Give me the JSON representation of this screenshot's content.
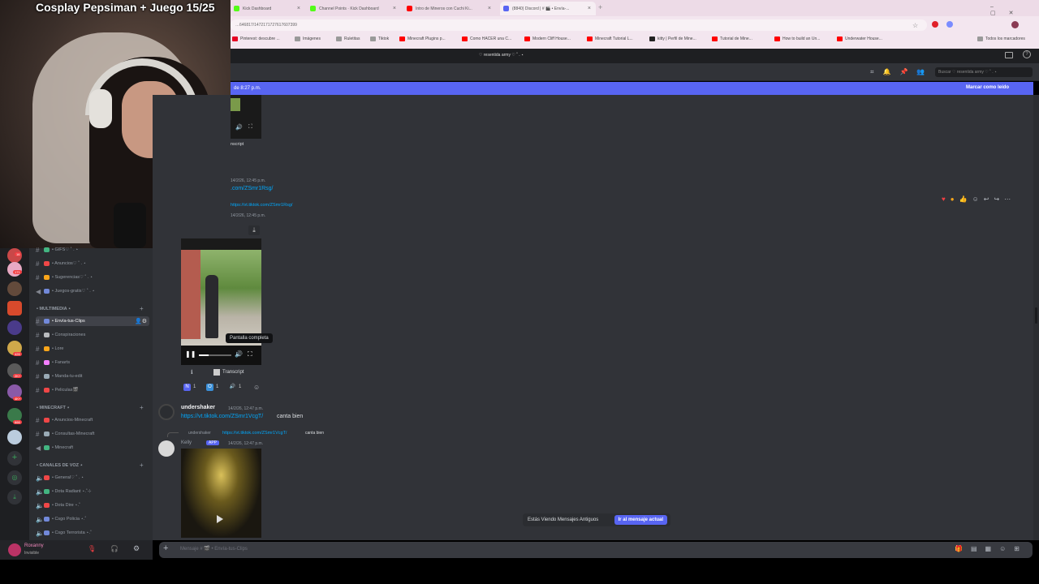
{
  "stream": {
    "title": "Cosplay Pepsiman + Juego 15/25"
  },
  "browser": {
    "tabs": [
      {
        "label": "Kick Dashboard",
        "color": "#53fc18"
      },
      {
        "label": "Channel Points · Kick Dashboard",
        "color": "#53fc18"
      },
      {
        "label": "Intro de Mineros con Cuchi Ki...",
        "color": "#ff0000"
      },
      {
        "label": "(8840) Discord | # 🎬 • Envía-...",
        "color": "#5865f2"
      }
    ],
    "url": "…646817/1472171727617607399",
    "bookmarks": [
      "Pinterest: descubre ...",
      "Imágenes",
      "Ruletitas",
      "Tiktok",
      "Minecraft Plugins p...",
      "Como HACER una C...",
      "Modern Cliff House...",
      "Minecraft Tutorial L...",
      "kitty | Perfil de Mine...",
      "Tutorial de Mine...",
      "How to build an Un...",
      "Underwater House..."
    ],
    "bookmarks_all": "Todos los marcadores"
  },
  "discord": {
    "server_name": "♡ resentida army ♡ ˚ . ⋆",
    "search_placeholder": "Buscar ♡ resentida army ♡ ˚ . ⋆",
    "new_since": "de 8:27 p.m.",
    "mark_read": "Marcar como leído",
    "channels": [
      {
        "name": "• GIFS♡ ˚ . ⋆",
        "color": "#43b581"
      },
      {
        "name": "• Anuncios♡ ˚ . ⋆",
        "color": "#f04747"
      },
      {
        "name": "• Sugerencias♡ ˚ . ⋆",
        "color": "#faa61a"
      },
      {
        "name": "• Juegos-gratis♡ ˚ . ⋆",
        "color": "#7289da"
      }
    ],
    "cat_multimedia": "• MULTIMEDIA ⋆",
    "multimedia_channels": [
      {
        "name": "• Envía-tus-Clips",
        "color": "#7289da",
        "active": true
      },
      {
        "name": "• Conspiraciones",
        "color": "#b9bbbe"
      },
      {
        "name": "• Lore",
        "color": "#faa61a"
      },
      {
        "name": "• Fanarts",
        "color": "#f47fff"
      },
      {
        "name": "• Manda-tu-edit",
        "color": "#99aab5"
      },
      {
        "name": "• Peliculas🎬",
        "color": "#f04747"
      }
    ],
    "cat_minecraft": "• MINECRAFT ⋆",
    "minecraft_channels": [
      {
        "name": "• Anuncios-Minecraft",
        "color": "#f04747"
      },
      {
        "name": "• Consultas-Minecraft",
        "color": "#99aab5"
      },
      {
        "name": "• Minecraft",
        "color": "#43b581"
      }
    ],
    "cat_voice": "• CANALES DE VOZ ⋆",
    "voice_channels": [
      {
        "name": "• General♡ ˚ . ⋆",
        "color": "#f04747"
      },
      {
        "name": "• Dota Radiant ⋆.˚⊹",
        "color": "#43b581"
      },
      {
        "name": "• Dota Dire ⋆.˚",
        "color": "#f04747"
      },
      {
        "name": "• Csgo Policia ⋆.˚",
        "color": "#7289da"
      },
      {
        "name": "• Csgo Terrorista ⋆.˚",
        "color": "#7289da"
      }
    ],
    "server_badges": [
      "16",
      "171",
      "426",
      "2K+",
      "4K+",
      "666"
    ],
    "user": {
      "name": "Roxanny",
      "status": "Invisible"
    },
    "messages": {
      "m1_time": "14/2/26, 12:45 p.m.",
      "m1_link": ".com/ZSmr1Rsg/",
      "m2_link": "https://vt.tiktok.com/ZSmr1Rsg/",
      "m2_time": "14/2/26, 12:45 p.m.",
      "transcript_top": "nscript",
      "tooltip": "Pantalla completa",
      "transcript": "Transcript",
      "reactions": [
        {
          "emoji": "N",
          "count": "1",
          "color": "#5865f2"
        },
        {
          "emoji": "O",
          "count": "1",
          "color": "#3a8fd8"
        },
        {
          "emoji": "🔊",
          "count": "1",
          "color": "#555"
        }
      ],
      "m3_author": "undershaker",
      "m3_time": "14/2/26, 12:47 p.m.",
      "m3_link": "https://vt.tiktok.com/ZSmr1VcgT/",
      "m3_text": "canta bien",
      "reply_author": "undershaker",
      "reply_link": "https://vt.tiktok.com/ZSmr1VcgT/",
      "reply_text": "canta bien",
      "m4_author": "Kelly",
      "m4_badge": "APP",
      "m4_time": "14/2/26, 12:47 p.m."
    },
    "old_messages": "Estás Viendo Mensajes Antiguos",
    "jump_present": "Ir al mensaje actual",
    "composer_placeholder": "Mensaje # 🎬 • Envía-tus-Clips"
  }
}
